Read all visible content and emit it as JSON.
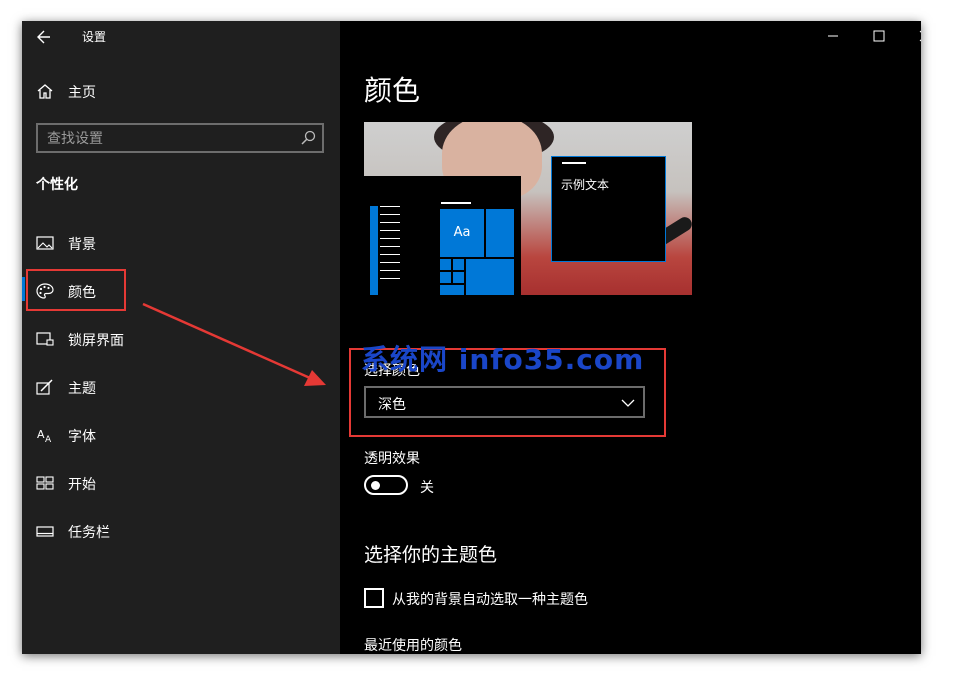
{
  "window": {
    "app_title": "设置"
  },
  "sidebar": {
    "home_label": "主页",
    "search_placeholder": "查找设置",
    "section_header": "个性化",
    "items": [
      {
        "label": "背景",
        "icon": "picture-icon"
      },
      {
        "label": "颜色",
        "icon": "palette-icon",
        "selected": true
      },
      {
        "label": "锁屏界面",
        "icon": "lockscreen-icon"
      },
      {
        "label": "主题",
        "icon": "theme-icon"
      },
      {
        "label": "字体",
        "icon": "font-icon"
      },
      {
        "label": "开始",
        "icon": "start-icon"
      },
      {
        "label": "任务栏",
        "icon": "taskbar-icon"
      }
    ]
  },
  "main": {
    "title": "颜色",
    "preview": {
      "tile_label": "Aa",
      "sample_text": "示例文本"
    },
    "choose_color_label": "选择颜色",
    "choose_color_value": "深色",
    "transparency_label": "透明效果",
    "transparency_state": "关",
    "accent_title": "选择你的主题色",
    "auto_accent_label": "从我的背景自动选取一种主题色",
    "recent_colors_label": "最近使用的颜色"
  },
  "annotation": {
    "watermark": "系统网 info35.com"
  },
  "colors": {
    "accent": "#0078d7",
    "sidebar_bg": "#1f1f1f",
    "main_bg": "#000000",
    "highlight": "#e53935"
  }
}
